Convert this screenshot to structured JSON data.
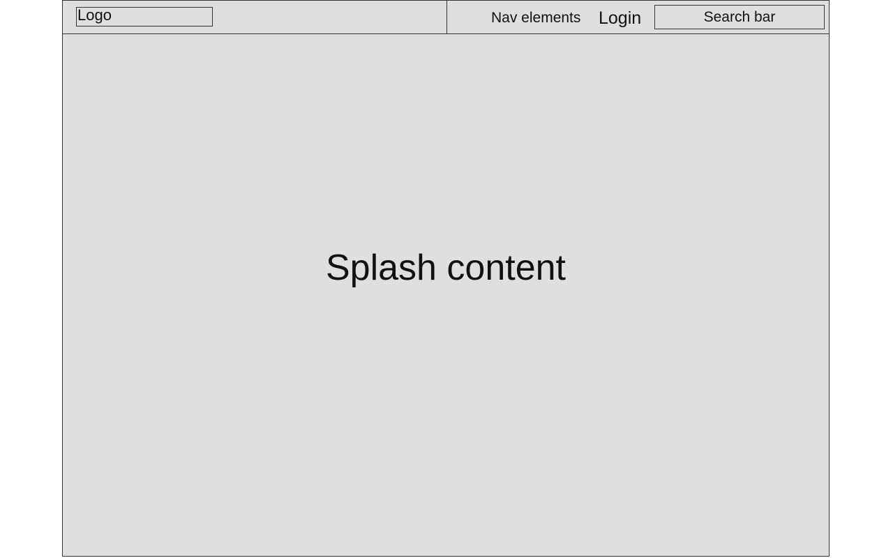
{
  "header": {
    "logo_text": "Logo",
    "nav_text": "Nav elements",
    "login_label": "Login",
    "search_placeholder": "Search bar"
  },
  "main": {
    "splash_text": "Splash content"
  },
  "colors": {
    "background": "#dfdfdf",
    "border": "#333333",
    "text": "#111111"
  }
}
